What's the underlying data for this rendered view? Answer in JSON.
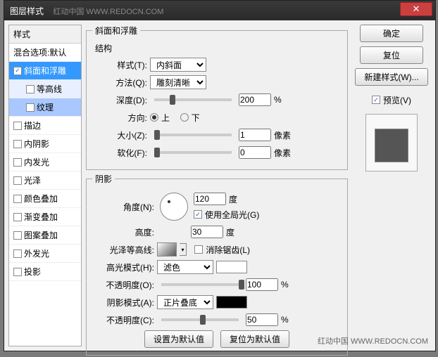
{
  "title": "图层样式",
  "watermark1": "红动中国  WWW.REDOCN.COM",
  "watermark2": "红动中国  WWW.REDOCN.COM",
  "sidebar": {
    "header": "样式",
    "blend": "混合选项:默认",
    "items": [
      {
        "label": "斜面和浮雕",
        "checked": true,
        "selected": true
      },
      {
        "label": "等高线",
        "checked": false,
        "sub": true
      },
      {
        "label": "纹理",
        "checked": false,
        "sub": true,
        "selected": true
      },
      {
        "label": "描边",
        "checked": false
      },
      {
        "label": "内阴影",
        "checked": false
      },
      {
        "label": "内发光",
        "checked": false
      },
      {
        "label": "光泽",
        "checked": false
      },
      {
        "label": "颜色叠加",
        "checked": false
      },
      {
        "label": "渐变叠加",
        "checked": false
      },
      {
        "label": "图案叠加",
        "checked": false
      },
      {
        "label": "外发光",
        "checked": false
      },
      {
        "label": "投影",
        "checked": false
      }
    ]
  },
  "bevel": {
    "legend": "斜面和浮雕",
    "struct": "结构",
    "style_l": "样式(T):",
    "style_v": "内斜面",
    "tech_l": "方法(Q):",
    "tech_v": "雕刻清晰",
    "depth_l": "深度(D):",
    "depth_v": "200",
    "pct": "%",
    "dir_l": "方向:",
    "up": "上",
    "down": "下",
    "size_l": "大小(Z):",
    "size_v": "1",
    "px": "像素",
    "soft_l": "软化(F):",
    "soft_v": "0"
  },
  "shade": {
    "legend": "阴影",
    "angle_l": "角度(N):",
    "angle_v": "120",
    "deg": "度",
    "global": "使用全局光(G)",
    "alt_l": "高度:",
    "alt_v": "30",
    "gloss_l": "光泽等高线:",
    "aa": "消除锯齿(L)",
    "hmode_l": "高光模式(H):",
    "hmode_v": "滤色",
    "hopac_l": "不透明度(O):",
    "hopac_v": "100",
    "smode_l": "阴影模式(A):",
    "smode_v": "正片叠底",
    "sopac_l": "不透明度(C):",
    "sopac_v": "50"
  },
  "footer": {
    "def": "设置为默认值",
    "reset": "复位为默认值"
  },
  "right": {
    "ok": "确定",
    "cancel": "复位",
    "new": "新建样式(W)...",
    "preview": "预览(V)"
  }
}
